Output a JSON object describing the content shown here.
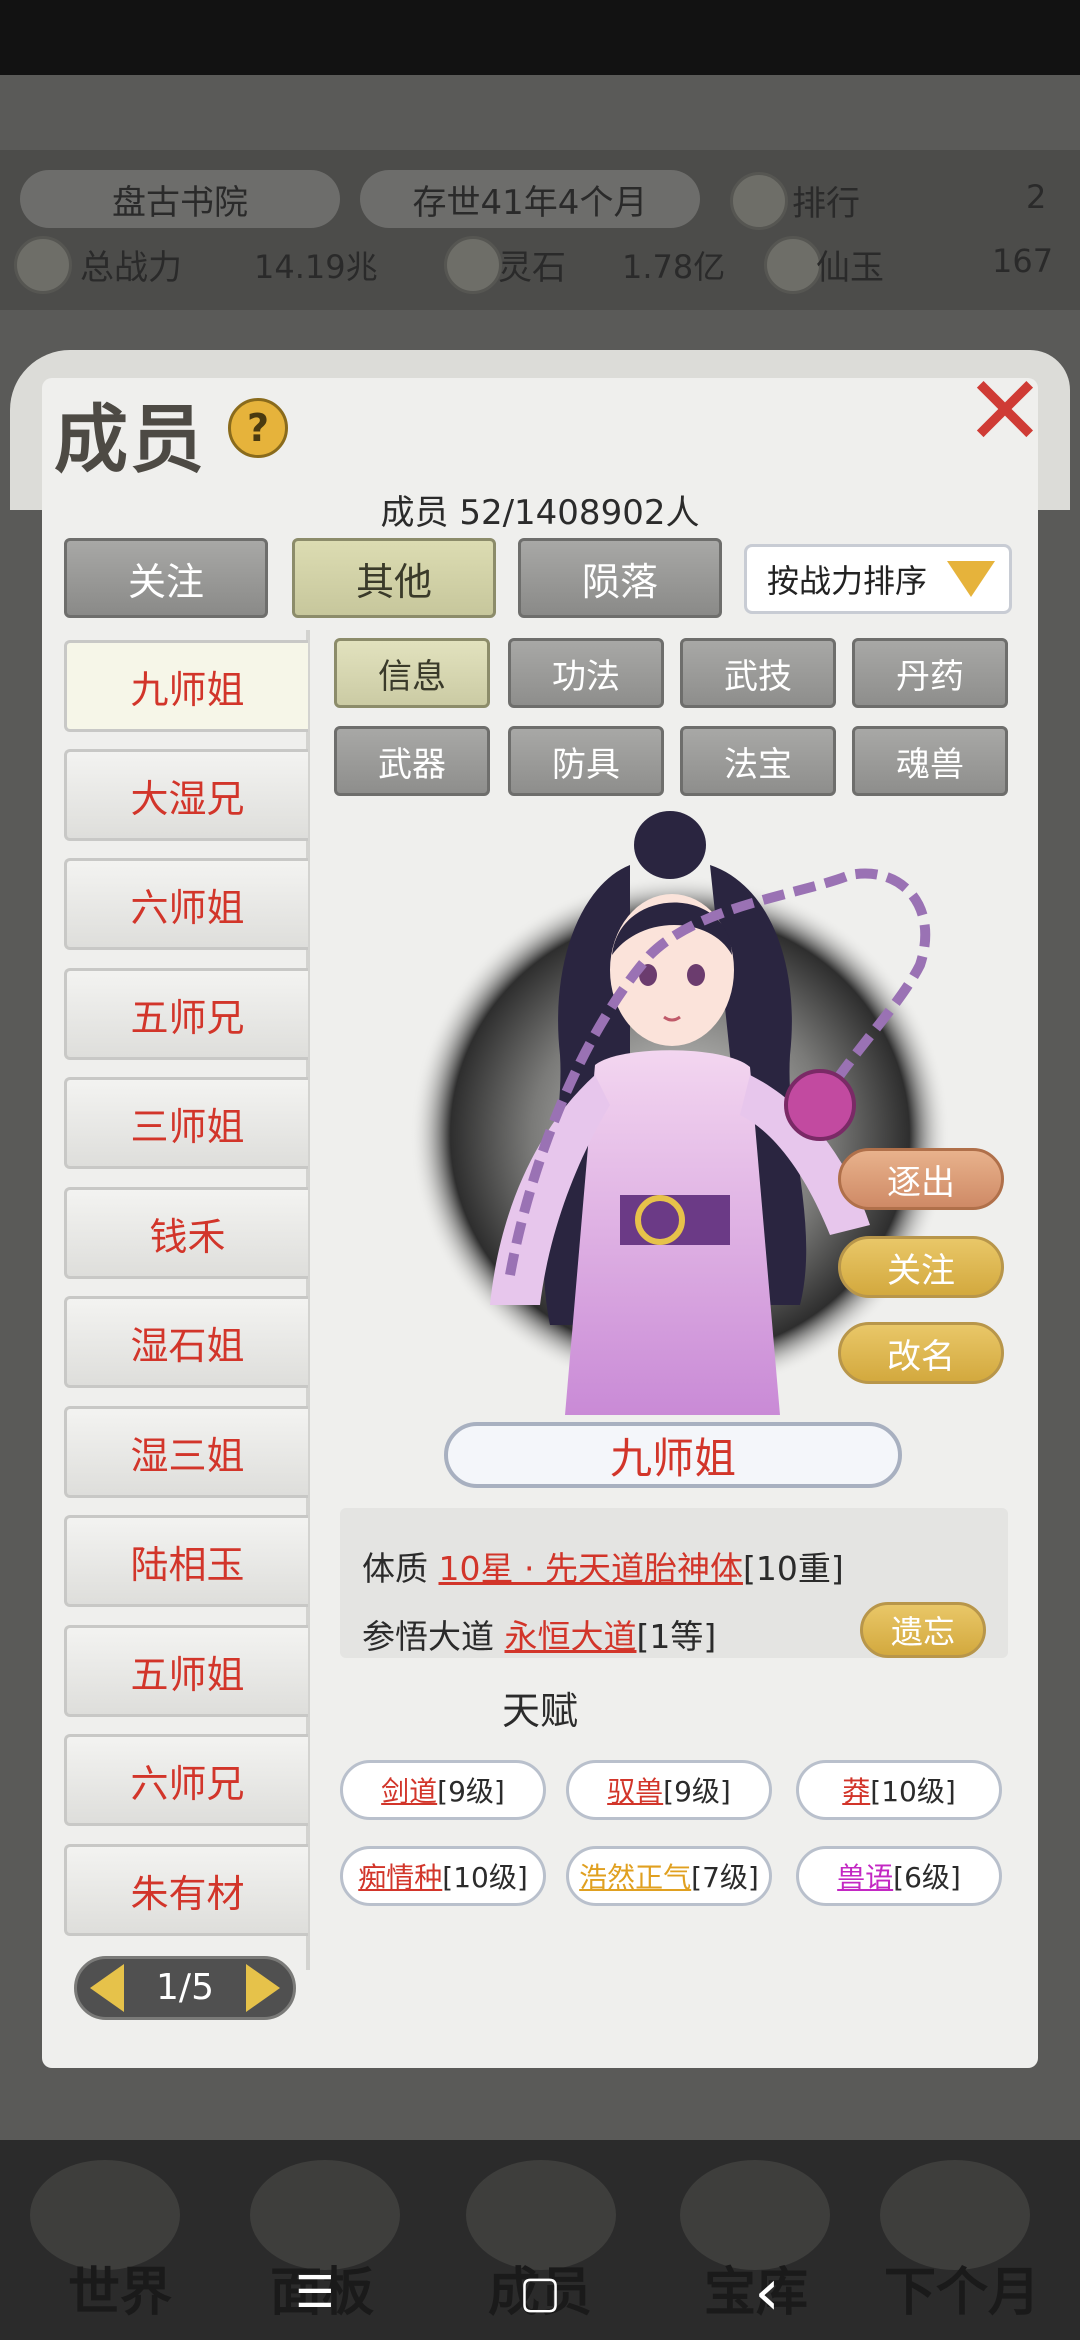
{
  "header": {
    "sect_name": "盘古书院",
    "age": "存世41年4个月",
    "rank_label": "排行",
    "rank_value": "2",
    "power_label": "总战力",
    "power_value": "14.19兆",
    "stone_label": "灵石",
    "stone_value": "1.78亿",
    "jade_label": "仙玉",
    "jade_value": "167"
  },
  "panel": {
    "title": "成员",
    "help_glyph": "?",
    "close_glyph": "✕",
    "member_count": "成员  52/1408902人",
    "tabs": [
      {
        "label": "关注"
      },
      {
        "label": "其他"
      },
      {
        "label": "陨落"
      }
    ],
    "sort_label": "按战力排序"
  },
  "members": [
    {
      "name": "九师姐"
    },
    {
      "name": "大湿兄"
    },
    {
      "name": "六师姐"
    },
    {
      "name": "五师兄"
    },
    {
      "name": "三师姐"
    },
    {
      "name": "钱禾"
    },
    {
      "name": "湿石姐"
    },
    {
      "name": "湿三姐"
    },
    {
      "name": "陆相玉"
    },
    {
      "name": "五师姐"
    },
    {
      "name": "六师兄"
    },
    {
      "name": "朱有材"
    }
  ],
  "pager": {
    "text": "1/5"
  },
  "subtabs": [
    {
      "label": "信息"
    },
    {
      "label": "功法"
    },
    {
      "label": "武技"
    },
    {
      "label": "丹药"
    },
    {
      "label": "武器"
    },
    {
      "label": "防具"
    },
    {
      "label": "法宝"
    },
    {
      "label": "魂兽"
    }
  ],
  "actions": {
    "expel": "逐出",
    "follow": "关注",
    "rename": "改名"
  },
  "character": {
    "name": "九师姐"
  },
  "info": {
    "physique_label": "体质",
    "physique_value": "10星 · 先天道胎神体",
    "physique_level": "[10重]",
    "dao_label": "参悟大道",
    "dao_value": "永恒大道",
    "dao_level": "[1等]",
    "forget_label": "遗忘"
  },
  "talent": {
    "title": "天赋",
    "items": [
      {
        "name": "剑道",
        "level": "[9级]",
        "color": "#d2352a"
      },
      {
        "name": "驭兽",
        "level": "[9级]",
        "color": "#d2352a"
      },
      {
        "name": "莽",
        "level": "[10级]",
        "color": "#d2352a"
      },
      {
        "name": "痴情种",
        "level": "[10级]",
        "color": "#d2352a"
      },
      {
        "name": "浩然正气",
        "level": "[7级]",
        "color": "#e0a020"
      },
      {
        "name": "兽语",
        "level": "[6级]",
        "color": "#c327c3"
      }
    ]
  },
  "bottom_nav": {
    "world": "世界",
    "panel": "面板",
    "members": "成员",
    "treasury": "宝库",
    "next_month": "下个月"
  },
  "system_nav": {
    "menu": "☰",
    "home": "▢",
    "back": "‹"
  }
}
